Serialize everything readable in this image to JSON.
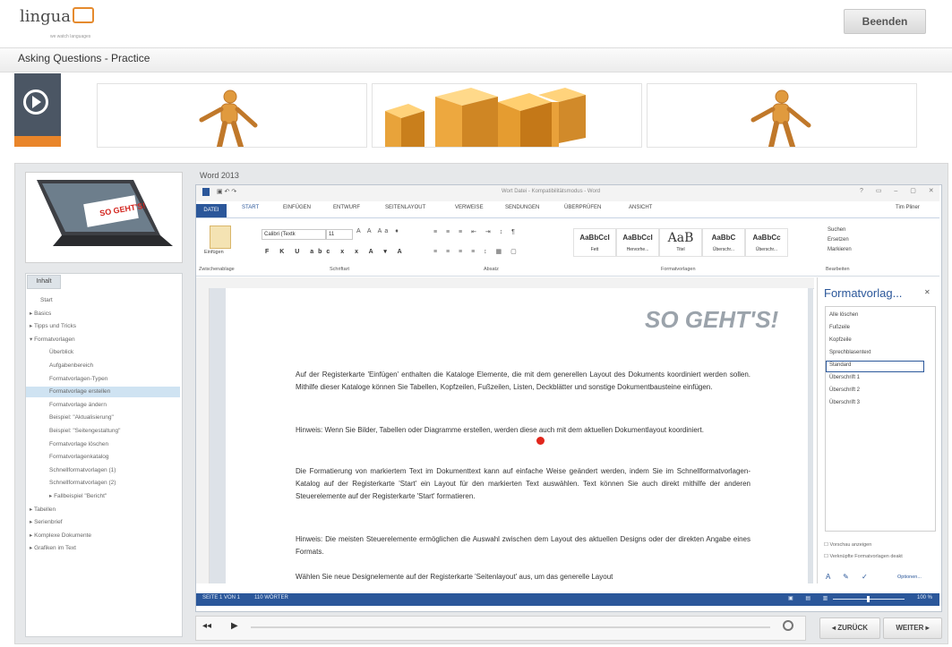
{
  "header": {
    "logo_text": "lingua",
    "logo_sub": "we watch languages",
    "exit_label": "Beenden"
  },
  "course_title": "Asking Questions - Practice",
  "module_title": "Word 2013",
  "thumbnail_brand": "SO GEHT'S!",
  "nav": {
    "tab_label": "Inhalt",
    "items": [
      {
        "label": "Start",
        "indent": 0,
        "marker": ""
      },
      {
        "label": "Basics",
        "indent": 0,
        "marker": "▸"
      },
      {
        "label": "Tipps und Tricks",
        "indent": 0,
        "marker": "▸"
      },
      {
        "label": "Formatvorlagen",
        "indent": 0,
        "marker": "▾"
      },
      {
        "label": "Überblick",
        "indent": 1,
        "marker": ""
      },
      {
        "label": "Aufgabenbereich",
        "indent": 1,
        "marker": ""
      },
      {
        "label": "Formatvorlagen-Typen",
        "indent": 1,
        "marker": ""
      },
      {
        "label": "Formatvorlage erstellen",
        "indent": 1,
        "marker": "",
        "selected": true
      },
      {
        "label": "Formatvorlage ändern",
        "indent": 1,
        "marker": ""
      },
      {
        "label": "Beispiel: \"Aktualisierung\"",
        "indent": 1,
        "marker": ""
      },
      {
        "label": "Beispiel: \"Seitengestaltung\"",
        "indent": 1,
        "marker": ""
      },
      {
        "label": "Formatvorlage löschen",
        "indent": 1,
        "marker": ""
      },
      {
        "label": "Formatvorlagenkatalog",
        "indent": 1,
        "marker": ""
      },
      {
        "label": "Schnellformatvorlagen (1)",
        "indent": 1,
        "marker": ""
      },
      {
        "label": "Schnellformatvorlagen (2)",
        "indent": 1,
        "marker": ""
      },
      {
        "label": "Fallbeispiel \"Bericht\"",
        "indent": 1,
        "marker": "▸"
      },
      {
        "label": "Tabellen",
        "indent": 0,
        "marker": "▸"
      },
      {
        "label": "Serienbrief",
        "indent": 0,
        "marker": "▸"
      },
      {
        "label": "Komplexe Dokumente",
        "indent": 0,
        "marker": "▸"
      },
      {
        "label": "Grafiken im Text",
        "indent": 0,
        "marker": "▸"
      }
    ]
  },
  "word": {
    "window_title": "Wort Datei - Kompatibilitätsmodus - Word",
    "user": "Tim Pliner",
    "tabs": [
      "DATEI",
      "START",
      "EINFÜGEN",
      "ENTWURF",
      "SEITENLAYOUT",
      "VERWEISE",
      "SENDUNGEN",
      "ÜBERPRÜFEN",
      "ANSICHT"
    ],
    "font_name": "Calibri (Textk",
    "font_size": "11",
    "paste_label": "Einfügen",
    "groups": [
      "Zwischenablage",
      "Schriftart",
      "Absatz",
      "Formatvorlagen",
      "Bearbeiten"
    ],
    "styles": [
      {
        "sample": "AaBbCcI",
        "name": "Fett"
      },
      {
        "sample": "AaBbCcI",
        "name": "Hervorhe..."
      },
      {
        "sample": "AaB",
        "name": "Titel"
      },
      {
        "sample": "AaBbC",
        "name": "Überschr..."
      },
      {
        "sample": "AaBbCc",
        "name": "Überschr..."
      }
    ],
    "editing": [
      "Suchen",
      "Ersetzen",
      "Markieren"
    ],
    "doc_logo": "SO GEHT'S!",
    "paragraphs": [
      "Auf der Registerkarte 'Einfügen' enthalten die Kataloge Elemente, die mit dem generellen Layout des Dokuments koordiniert werden sollen. Mithilfe dieser Kataloge können Sie Tabellen, Kopfzeilen, Fußzeilen, Listen, Deckblätter und sonstige Dokumentbausteine einfügen.",
      "Hinweis: Wenn Sie Bilder, Tabellen oder Diagramme erstellen, werden diese auch mit dem aktuellen Dokumentlayout koordiniert.",
      "Die Formatierung von markiertem Text im Dokumenttext kann auf einfache Weise geändert werden, indem Sie im Schnellformatvorlagen-Katalog auf der Registerkarte 'Start' ein Layout für den markierten Text auswählen. Text können Sie auch direkt mithilfe der anderen Steuerelemente auf der Registerkarte 'Start' formatieren.",
      "Hinweis: Die meisten Steuerelemente ermöglichen die Auswahl zwischen dem Layout des aktuellen Designs oder der direkten Angabe eines Formats.",
      "Wählen Sie neue Designelemente auf der Registerkarte 'Seitenlayout' aus, um das generelle Layout"
    ],
    "pane": {
      "title": "Formatvorlag...",
      "items": [
        "Alle löschen",
        "Fußzeile",
        "Kopfzeile",
        "Sprechblasentext",
        "Standard",
        "Überschrift 1",
        "Überschrift 2",
        "Überschrift 3"
      ],
      "selected_index": 4,
      "option1": "Vorschau anzeigen",
      "option2": "Verknüpfte Formatvorlagen deakt",
      "options_link": "Optionen..."
    },
    "status": {
      "page": "SEITE 1 VON 1",
      "words": "110 WÖRTER",
      "zoom": "100 %"
    }
  },
  "player": {
    "back_label": "◂ ZURÜCK",
    "next_label": "WEITER ▸"
  },
  "colors": {
    "word_blue": "#2b579a",
    "orange": "#e9852a",
    "nav_selected": "#cfe3f2"
  }
}
